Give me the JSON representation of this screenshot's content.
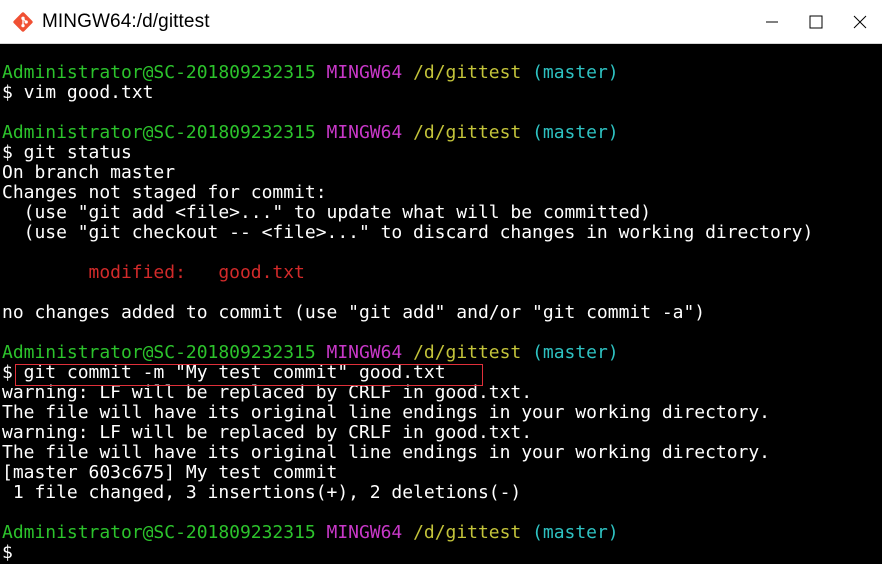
{
  "window": {
    "title": "MINGW64:/d/gittest",
    "icons": {
      "app": "git-diamond-icon",
      "minimize": "minimize-icon",
      "maximize": "maximize-icon",
      "close": "close-icon"
    }
  },
  "colors": {
    "green": "#2cc32c",
    "magenta": "#c838c8",
    "yellow": "#c3c33a",
    "cyan": "#2ec2c2",
    "red": "#d22a2a",
    "highlight": "#e0303a"
  },
  "prompt": {
    "user": "Administrator@SC-201809232315",
    "shell": "MINGW64",
    "path": "/d/gittest",
    "branch": "(master)",
    "symbol": "$"
  },
  "lines": {
    "l2_cmd": " vim good.txt",
    "l5_cmd": " git status",
    "l6": "On branch master",
    "l7": "Changes not staged for commit:",
    "l8": "  (use \"git add <file>...\" to update what will be committed)",
    "l9": "  (use \"git checkout -- <file>...\" to discard changes in working directory)",
    "l11_label": "        modified:   ",
    "l11_file": "good.txt",
    "l13": "no changes added to commit (use \"git add\" and/or \"git commit -a\")",
    "l16_cmd": " git commit -m \"My test commit\" good.txt",
    "l17": "warning: LF will be replaced by CRLF in good.txt.",
    "l18": "The file will have its original line endings in your working directory.",
    "l19": "warning: LF will be replaced by CRLF in good.txt.",
    "l20": "The file will have its original line endings in your working directory.",
    "l21": "[master 603c675] My test commit",
    "l22": " 1 file changed, 3 insertions(+), 2 deletions(-)"
  }
}
